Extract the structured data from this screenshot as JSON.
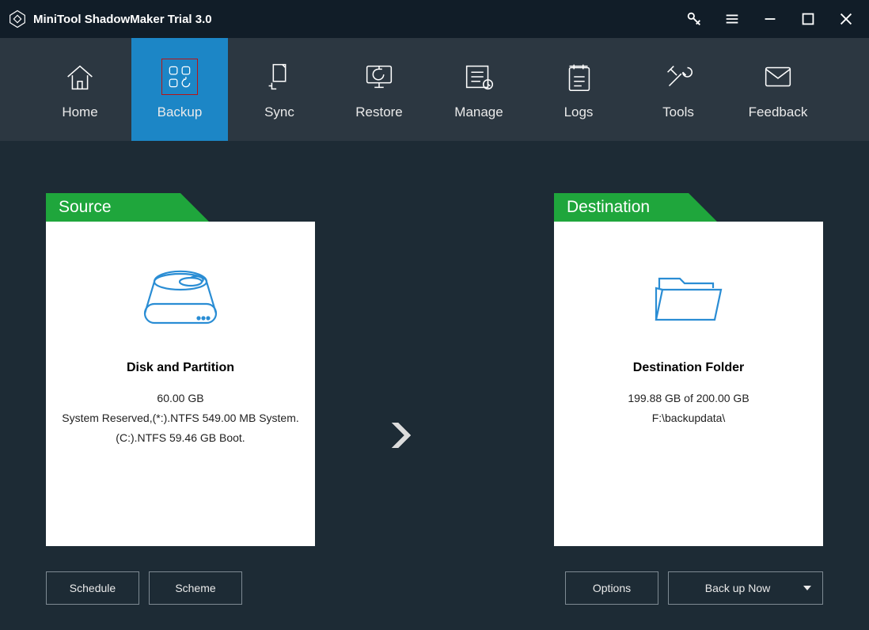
{
  "app": {
    "title": "MiniTool ShadowMaker Trial 3.0"
  },
  "nav": [
    {
      "label": "Home"
    },
    {
      "label": "Backup"
    },
    {
      "label": "Sync"
    },
    {
      "label": "Restore"
    },
    {
      "label": "Manage"
    },
    {
      "label": "Logs"
    },
    {
      "label": "Tools"
    },
    {
      "label": "Feedback"
    }
  ],
  "source": {
    "header": "Source",
    "title": "Disk and Partition",
    "size": "60.00 GB",
    "details1": "System Reserved,(*:).NTFS 549.00 MB System.",
    "details2": "(C:).NTFS 59.46 GB Boot."
  },
  "destination": {
    "header": "Destination",
    "title": "Destination Folder",
    "size": "199.88 GB of 200.00 GB",
    "path": "F:\\backupdata\\"
  },
  "buttons": {
    "schedule": "Schedule",
    "scheme": "Scheme",
    "options": "Options",
    "backupNow": "Back up Now"
  }
}
